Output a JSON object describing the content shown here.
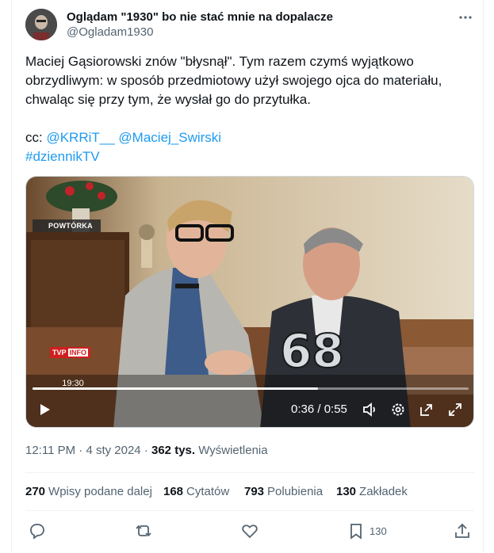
{
  "author": {
    "name": "Oglądam \"1930\" bo nie stać mnie na dopalacze",
    "handle": "@Ogladam1930"
  },
  "tweet": {
    "text_line1": "Maciej Gąsiorowski znów \"błysnął\". Tym razem czymś wyjątkowo",
    "text_line2": "obrzydliwym: w sposób przedmiotowy użył swojego ojca do materiału,",
    "text_line3": "chwaląc się przy tym, że wysłał go do przytułka.",
    "cc_prefix": "cc: ",
    "mention1": "@KRRiT__",
    "mention2": "@Maciej_Swirski",
    "hashtag": "#dziennikTV"
  },
  "video": {
    "badge": "POWTÓRKA",
    "channel_logo_a": "TVP",
    "channel_logo_b": "INFO",
    "clock_time": "19:30",
    "time_display": "0:36 / 0:55",
    "progress_fraction": 0.655
  },
  "meta": {
    "time": "12:11 PM",
    "sep1": " · ",
    "date": "4 sty 2024",
    "sep2": " · ",
    "views_count": "362 tys.",
    "views_label": " Wyświetlenia"
  },
  "stats": {
    "retweets_count": "270",
    "retweets_label": "Wpisy podane dalej",
    "quotes_count": "168",
    "quotes_label": "Cytatów",
    "likes_count": "793",
    "likes_label": "Polubienia",
    "bookmarks_count": "130",
    "bookmarks_label": "Zakładek"
  },
  "actions": {
    "bookmark_count": "130"
  },
  "icons": [
    "more-icon",
    "reply-icon",
    "retweet-icon",
    "like-icon",
    "bookmark-icon",
    "share-icon",
    "play-icon",
    "volume-icon",
    "settings-icon",
    "popout-icon",
    "fullscreen-icon"
  ],
  "colors": {
    "accent": "#1d9bf0",
    "secondary_text": "#536471",
    "primary_text": "#0f1419"
  }
}
